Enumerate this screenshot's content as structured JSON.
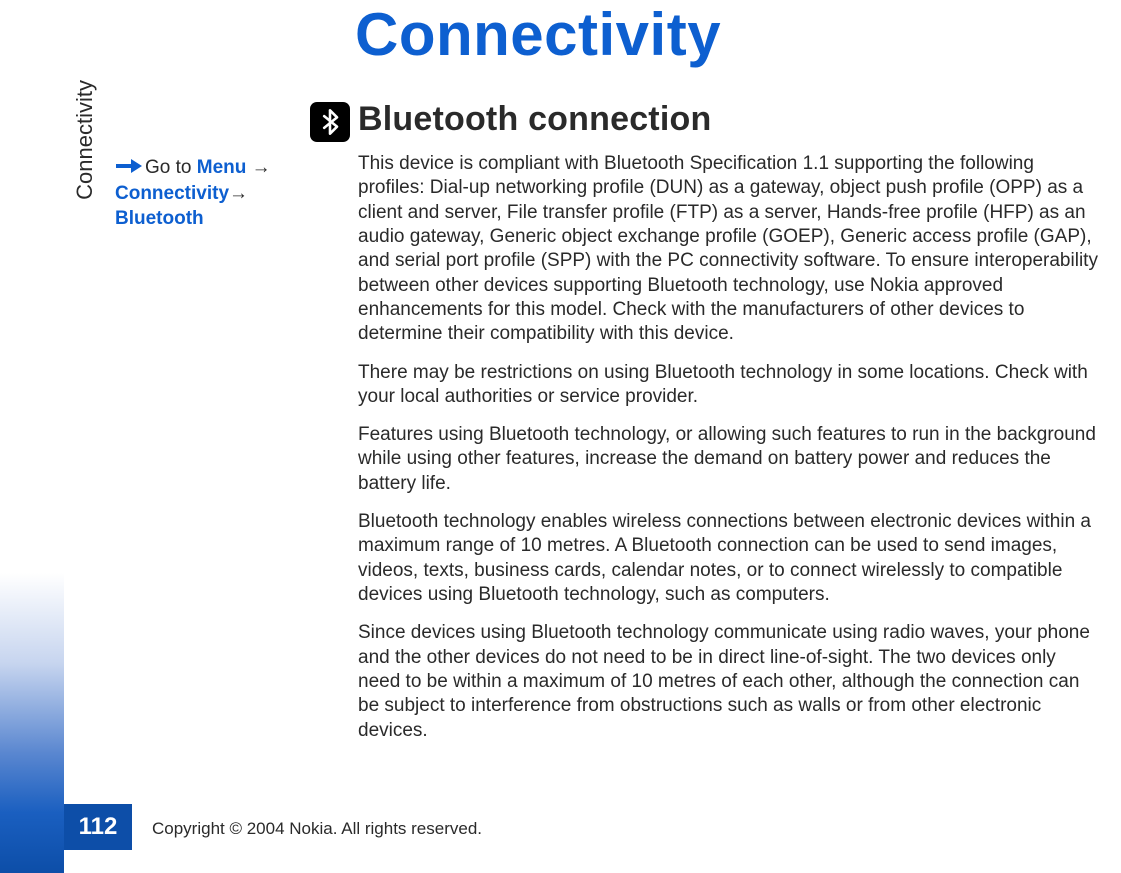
{
  "sidebar": {
    "label": "Connectivity"
  },
  "page": {
    "number": "112",
    "copyright": "Copyright © 2004 Nokia. All rights reserved.",
    "title": "Connectivity"
  },
  "callout": {
    "goto": "Go to ",
    "menu": "Menu",
    "arrow1": " →",
    "connectivity": "Connectivity",
    "arrow2": "→",
    "bluetooth": "Bluetooth"
  },
  "section": {
    "heading": "Bluetooth connection"
  },
  "body": {
    "p1": "This device is compliant with Bluetooth Specification 1.1 supporting the following profiles: Dial-up networking profile (DUN) as a gateway, object push profile (OPP) as a client and server, File transfer profile (FTP) as a server, Hands-free profile (HFP) as an audio gateway, Generic object exchange profile (GOEP), Generic access profile (GAP), and serial port profile (SPP) with the PC connectivity software. To ensure interoperability between other devices supporting Bluetooth technology, use Nokia approved enhancements for this model. Check with the manufacturers of other devices to determine their compatibility with this device.",
    "p2": "There may be restrictions on using Bluetooth technology in some locations. Check with your local authorities or service provider.",
    "p3": "Features using Bluetooth technology, or allowing such features to run in the background while using other features, increase the demand on battery power and reduces the battery life.",
    "p4": "Bluetooth technology enables wireless connections between electronic devices within a maximum range of 10 metres. A Bluetooth connection can be used to send images, videos, texts, business cards, calendar notes, or to connect wirelessly to compatible devices using Bluetooth technology, such as computers.",
    "p5": "Since devices using Bluetooth technology communicate using radio waves, your phone and the other devices do not need to be in direct line-of-sight. The two devices only need to be within a maximum of 10 metres of each other, although the connection can be subject to interference from obstructions such as walls or from other electronic devices."
  }
}
